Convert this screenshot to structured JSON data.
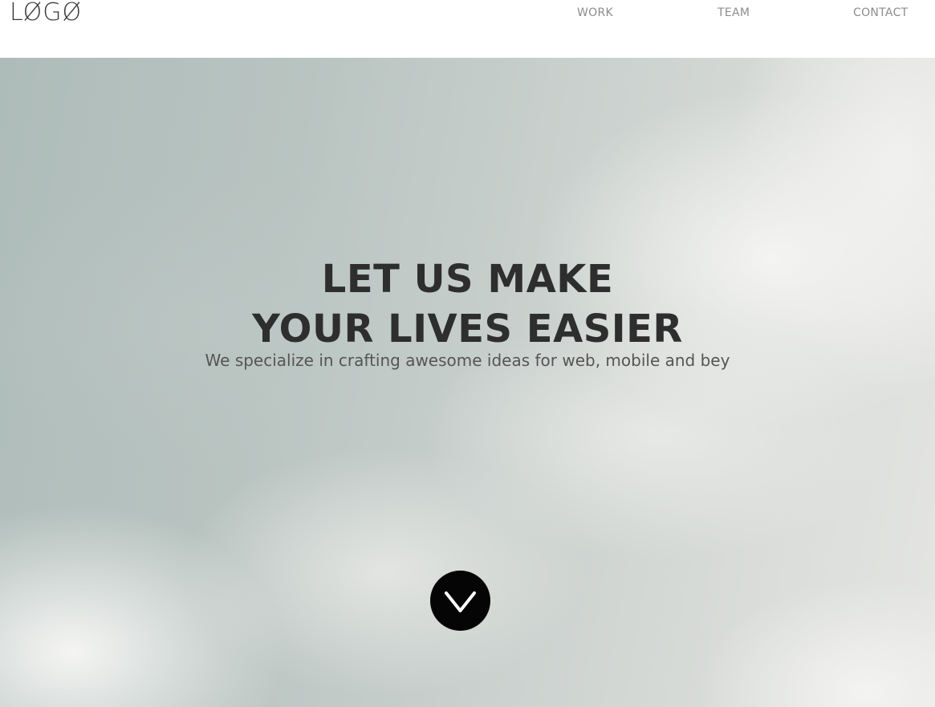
{
  "header": {
    "logo": "LØGØ",
    "nav": {
      "work": "WORK",
      "team": "TEAM",
      "contact": "CONTACT"
    }
  },
  "hero": {
    "headline_line1": "LET US MAKE",
    "headline_line2": "YOUR LIVES EASIER",
    "subline": "We specialize in crafting awesome ideas for web, mobile and bey",
    "scroll_icon": "chevron-down-icon"
  },
  "colors": {
    "headline": "#2e2e2e",
    "nav_text": "#8c8c8c",
    "scroll_button": "#050505"
  }
}
